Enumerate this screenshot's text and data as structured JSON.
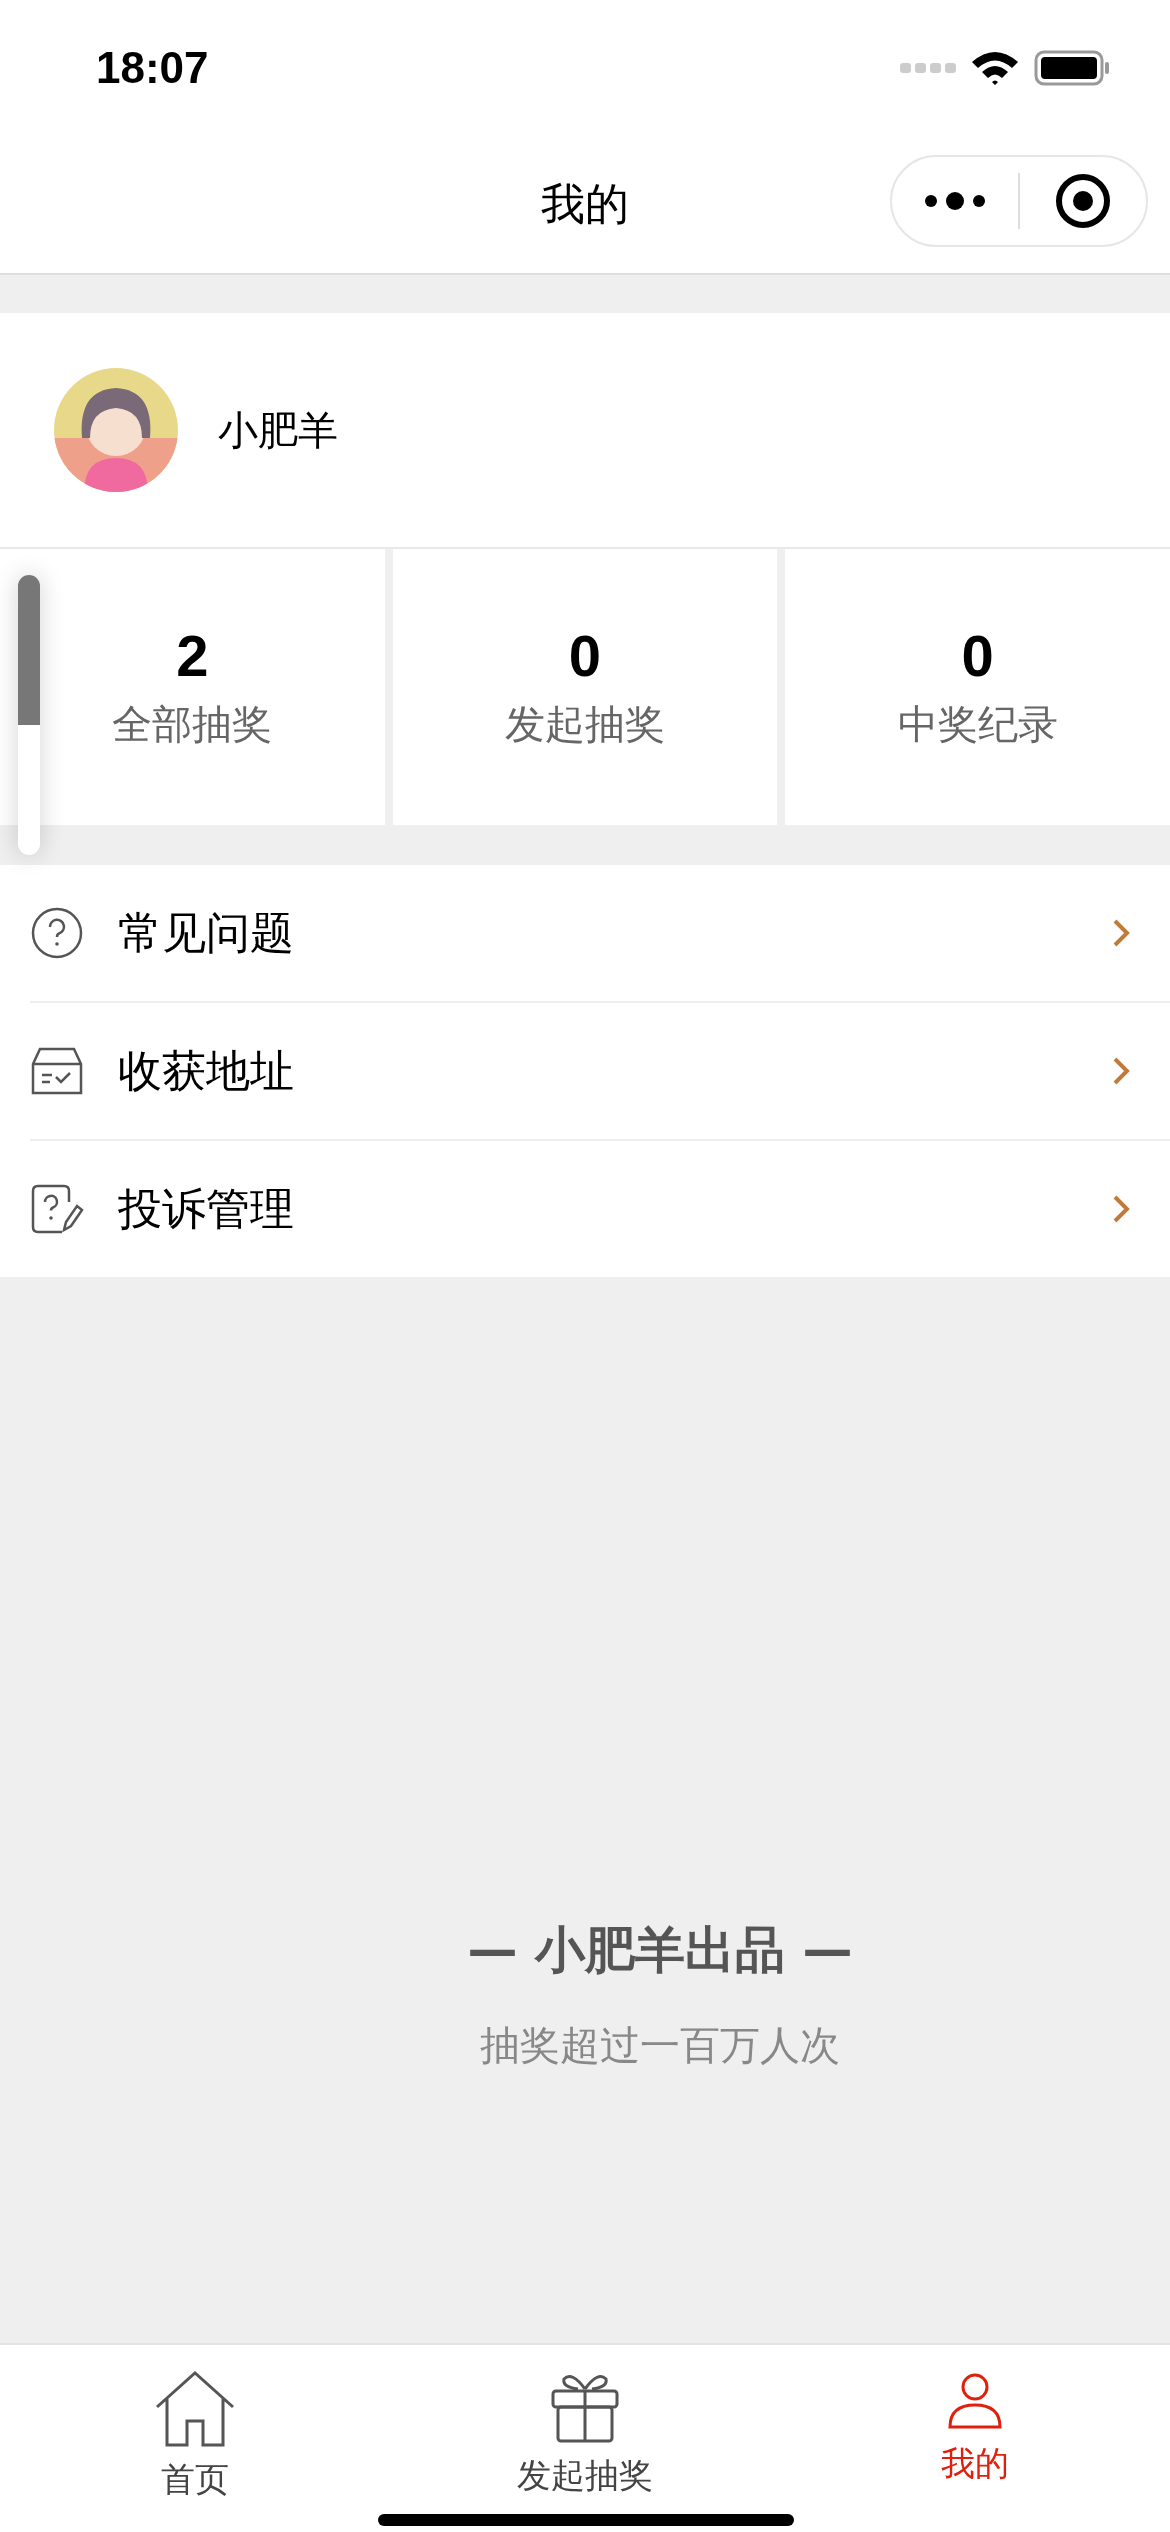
{
  "status_bar": {
    "time": "18:07"
  },
  "nav_bar": {
    "title": "我的"
  },
  "profile": {
    "name": "小肥羊"
  },
  "stats": [
    {
      "value": "2",
      "label": "全部抽奖"
    },
    {
      "value": "0",
      "label": "发起抽奖"
    },
    {
      "value": "0",
      "label": "中奖纪录"
    }
  ],
  "menu": [
    {
      "label": "常见问题"
    },
    {
      "label": "收获地址"
    },
    {
      "label": "投诉管理"
    }
  ],
  "footer": {
    "title": "— 小肥羊出品 —",
    "subtitle": "抽奖超过一百万人次"
  },
  "tab_bar": [
    {
      "label": "首页",
      "selected": false
    },
    {
      "label": "发起抽奖",
      "selected": false
    },
    {
      "label": "我的",
      "selected": true
    }
  ]
}
